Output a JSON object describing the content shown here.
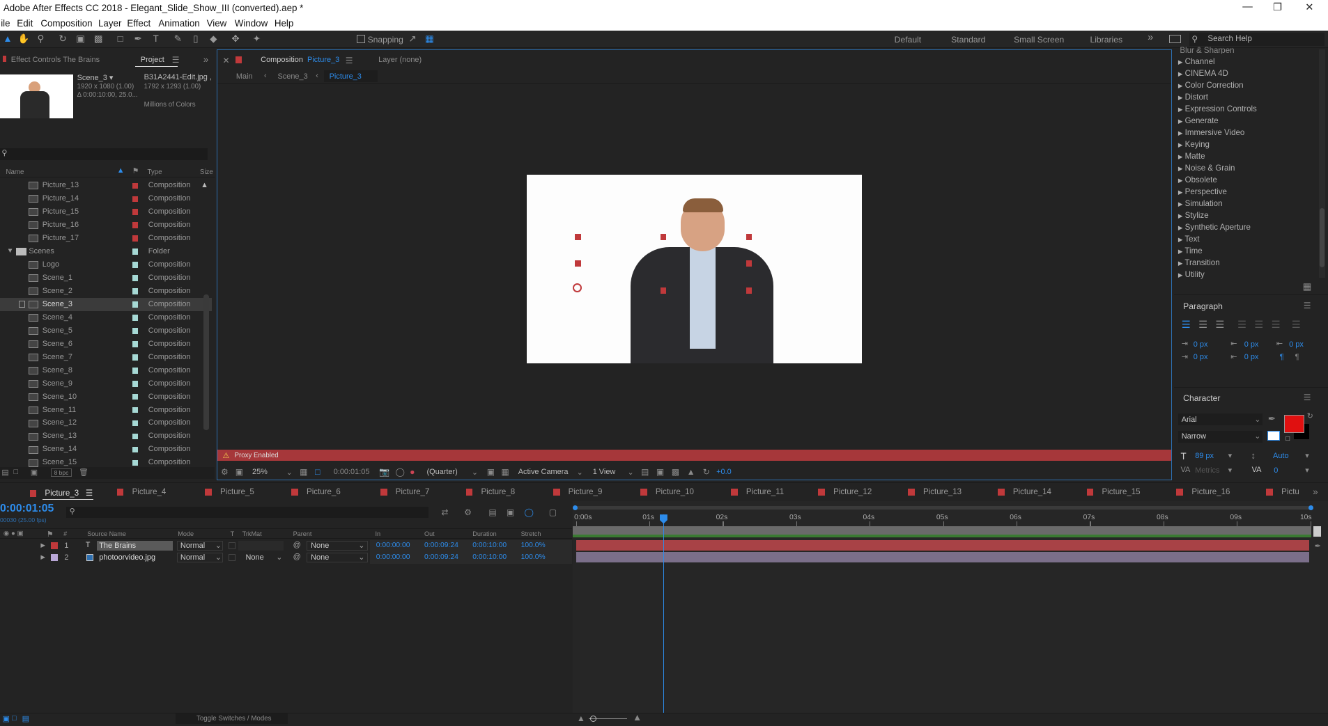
{
  "app": {
    "title": "Adobe After Effects CC 2018 - Elegant_Slide_Show_III (converted).aep *"
  },
  "menu": [
    "ile",
    "Edit",
    "Composition",
    "Layer",
    "Effect",
    "Animation",
    "View",
    "Window",
    "Help"
  ],
  "window_controls": {
    "minimize": "—",
    "maximize": "❐",
    "close": "✕"
  },
  "toolbar": {
    "snapping_label": "Snapping",
    "workspaces": [
      "Default",
      "Standard",
      "Small Screen",
      "Libraries"
    ],
    "more": "»",
    "search_placeholder": "Search Help"
  },
  "left_panel": {
    "tab_effect_controls": "Effect Controls The Brains",
    "tab_project": "Project",
    "selected_item": {
      "name": "Scene_3 ▾",
      "dims": "1920 x 1080 (1.00)",
      "duration": "Δ 0:00:10:00, 25.0..."
    },
    "footage_item": {
      "name": "B31A2441-Edit.jpg ,",
      "dims": "1792 x 1293 (1.00)",
      "colors": "Millions of Colors"
    },
    "columns": {
      "name": "Name",
      "type": "Type",
      "size": "Size"
    },
    "items": [
      {
        "name": "Picture_13",
        "type": "Composition",
        "color": "#c0393b",
        "kind": "comp"
      },
      {
        "name": "Picture_14",
        "type": "Composition",
        "color": "#c0393b",
        "kind": "comp"
      },
      {
        "name": "Picture_15",
        "type": "Composition",
        "color": "#c0393b",
        "kind": "comp"
      },
      {
        "name": "Picture_16",
        "type": "Composition",
        "color": "#c0393b",
        "kind": "comp"
      },
      {
        "name": "Picture_17",
        "type": "Composition",
        "color": "#c0393b",
        "kind": "comp"
      },
      {
        "name": "Scenes",
        "type": "Folder",
        "color": "#a6d9d5",
        "kind": "folder"
      },
      {
        "name": "Logo",
        "type": "Composition",
        "color": "#a6d9d5",
        "kind": "comp"
      },
      {
        "name": "Scene_1",
        "type": "Composition",
        "color": "#a6d9d5",
        "kind": "comp"
      },
      {
        "name": "Scene_2",
        "type": "Composition",
        "color": "#a6d9d5",
        "kind": "comp"
      },
      {
        "name": "Scene_3",
        "type": "Composition",
        "color": "#a6d9d5",
        "kind": "comp",
        "selected": true
      },
      {
        "name": "Scene_4",
        "type": "Composition",
        "color": "#a6d9d5",
        "kind": "comp"
      },
      {
        "name": "Scene_5",
        "type": "Composition",
        "color": "#a6d9d5",
        "kind": "comp"
      },
      {
        "name": "Scene_6",
        "type": "Composition",
        "color": "#a6d9d5",
        "kind": "comp"
      },
      {
        "name": "Scene_7",
        "type": "Composition",
        "color": "#a6d9d5",
        "kind": "comp"
      },
      {
        "name": "Scene_8",
        "type": "Composition",
        "color": "#a6d9d5",
        "kind": "comp"
      },
      {
        "name": "Scene_9",
        "type": "Composition",
        "color": "#a6d9d5",
        "kind": "comp"
      },
      {
        "name": "Scene_10",
        "type": "Composition",
        "color": "#a6d9d5",
        "kind": "comp"
      },
      {
        "name": "Scene_11",
        "type": "Composition",
        "color": "#a6d9d5",
        "kind": "comp"
      },
      {
        "name": "Scene_12",
        "type": "Composition",
        "color": "#a6d9d5",
        "kind": "comp"
      },
      {
        "name": "Scene_13",
        "type": "Composition",
        "color": "#a6d9d5",
        "kind": "comp"
      },
      {
        "name": "Scene_14",
        "type": "Composition",
        "color": "#a6d9d5",
        "kind": "comp"
      },
      {
        "name": "Scene_15",
        "type": "Composition",
        "color": "#a6d9d5",
        "kind": "comp"
      }
    ],
    "bpc": "8 bpc"
  },
  "viewer": {
    "tab_composition": "Composition",
    "tab_composition_name": "Picture_3",
    "tab_layer": "Layer (none)",
    "breadcrumbs": [
      "Main",
      "Scene_3",
      "Picture_3"
    ],
    "proxy_warning": "Proxy Enabled",
    "zoom": "25%",
    "timecode": "0:00:01:05",
    "resolution": "(Quarter)",
    "camera": "Active Camera",
    "views": "1 View",
    "exposure": "+0.0"
  },
  "effects": {
    "top_cut": "Blur & Sharpen",
    "categories": [
      "Channel",
      "CINEMA 4D",
      "Color Correction",
      "Distort",
      "Expression Controls",
      "Generate",
      "Immersive Video",
      "Keying",
      "Matte",
      "Noise & Grain",
      "Obsolete",
      "Perspective",
      "Simulation",
      "Stylize",
      "Synthetic Aperture",
      "Text",
      "Time",
      "Transition",
      "Utility"
    ]
  },
  "paragraph": {
    "title": "Paragraph",
    "values": [
      "0 px",
      "0 px",
      "0 px",
      "0 px",
      "0 px"
    ]
  },
  "character": {
    "title": "Character",
    "font": "Arial",
    "style": "Narrow",
    "size": "89 px",
    "leading": "Auto",
    "kerning": "Metrics",
    "tracking": "0",
    "fill_color": "#e01010"
  },
  "timeline": {
    "tabs": [
      "Picture_3",
      "Picture_4",
      "Picture_5",
      "Picture_6",
      "Picture_7",
      "Picture_8",
      "Picture_9",
      "Picture_10",
      "Picture_11",
      "Picture_12",
      "Picture_13",
      "Picture_14",
      "Picture_15",
      "Picture_16",
      "Pictu"
    ],
    "timecode": "0:00:01:05",
    "frame_info": "00030 (25.00 fps)",
    "columns": {
      "num": "#",
      "source": "Source Name",
      "mode": "Mode",
      "t": "T",
      "trkmat": "TrkMat",
      "parent": "Parent",
      "in": "In",
      "out": "Out",
      "duration": "Duration",
      "stretch": "Stretch"
    },
    "layers": [
      {
        "num": "1",
        "name": "The Brains",
        "mode": "Normal",
        "trkmat": "",
        "parent": "None",
        "in": "0:00:00:00",
        "out": "0:00:09:24",
        "duration": "0:00:10:00",
        "stretch": "100.0%",
        "color": "#c0393b",
        "icon": "T"
      },
      {
        "num": "2",
        "name": "photoorvideo.jpg",
        "mode": "Normal",
        "trkmat": "None",
        "parent": "None",
        "in": "0:00:00:00",
        "out": "0:00:09:24",
        "duration": "0:00:10:00",
        "stretch": "100.0%",
        "color": "#b8a6d6",
        "icon": "img"
      }
    ],
    "ruler": [
      "0:00s",
      "01s",
      "02s",
      "03s",
      "04s",
      "05s",
      "06s",
      "07s",
      "08s",
      "09s",
      "10s"
    ],
    "toggle": "Toggle Switches / Modes"
  }
}
